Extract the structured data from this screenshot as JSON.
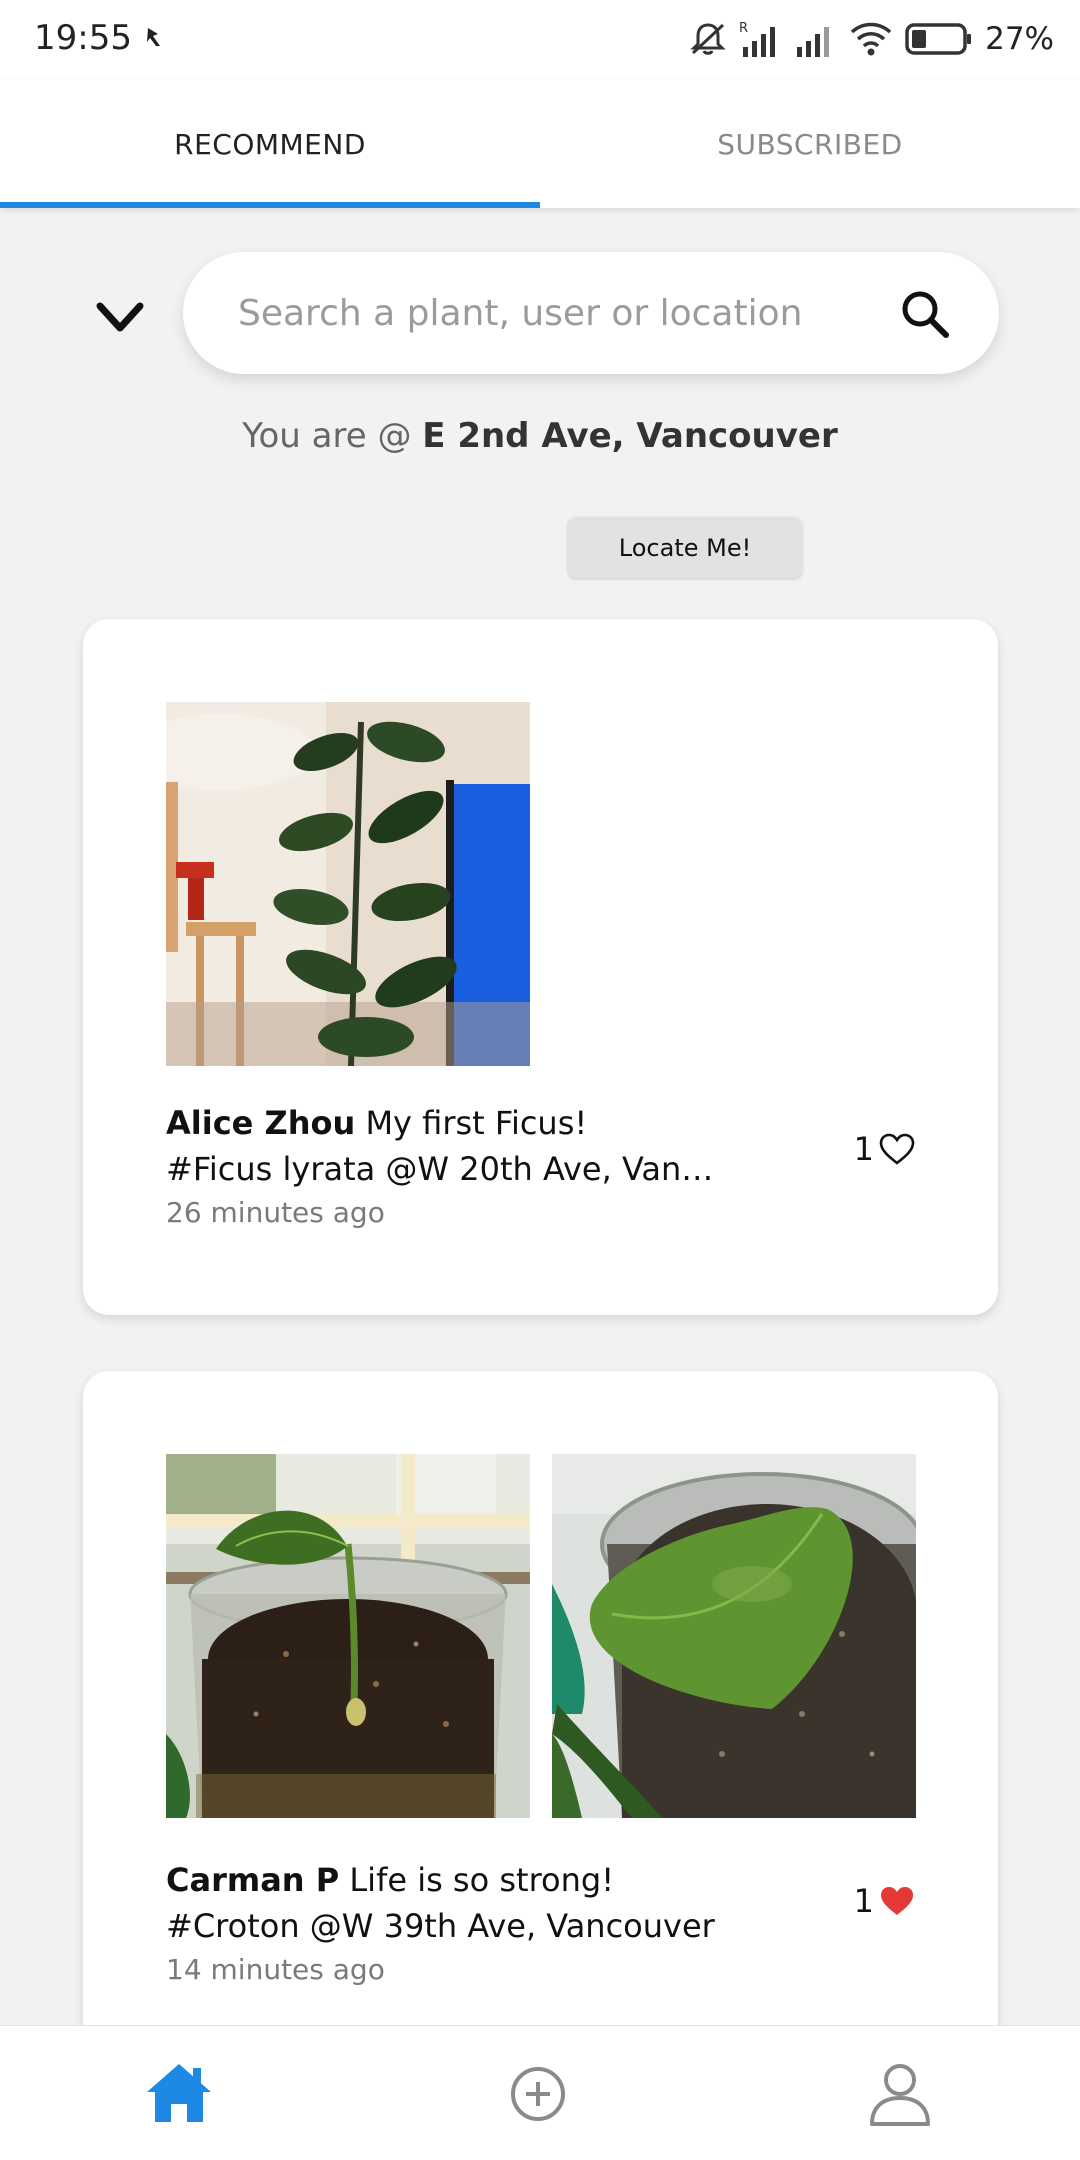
{
  "status_bar": {
    "time": "19:55",
    "battery": "27%",
    "icons": [
      "notification-muted-icon",
      "signal-roaming-icon",
      "signal-icon",
      "wifi-icon",
      "battery-icon"
    ]
  },
  "tabs": [
    {
      "label": "RECOMMEND",
      "active": true
    },
    {
      "label": "SUBSCRIBED",
      "active": false
    }
  ],
  "search": {
    "placeholder": "Search a plant, user or location",
    "value": ""
  },
  "location": {
    "prefix": "You are @ ",
    "place": "E 2nd Ave, Vancouver",
    "locate_button": "Locate Me!"
  },
  "posts": [
    {
      "user": "Alice Zhou",
      "caption": "My first Ficus!",
      "tags_location": "#Ficus lyrata @W 20th Ave, Vanco…",
      "time": "26 minutes ago",
      "likes": "1",
      "liked": false,
      "photos": [
        "ficus-plant-photo"
      ]
    },
    {
      "user": "Carman P",
      "caption": "Life is so strong!",
      "tags_location": "#Croton @W 39th Ave, Vancouver",
      "time": "14 minutes ago",
      "likes": "1",
      "liked": true,
      "photos": [
        "croton-seedling-photo",
        "croton-leaf-closeup-photo"
      ]
    }
  ],
  "bottom_nav": [
    {
      "name": "home",
      "icon": "home-icon",
      "active": true
    },
    {
      "name": "add",
      "icon": "add-circle-icon",
      "active": false
    },
    {
      "name": "profile",
      "icon": "user-icon",
      "active": false
    }
  ],
  "colors": {
    "accent": "#1e88e5",
    "liked": "#e53935",
    "background": "#f2f2f2"
  }
}
